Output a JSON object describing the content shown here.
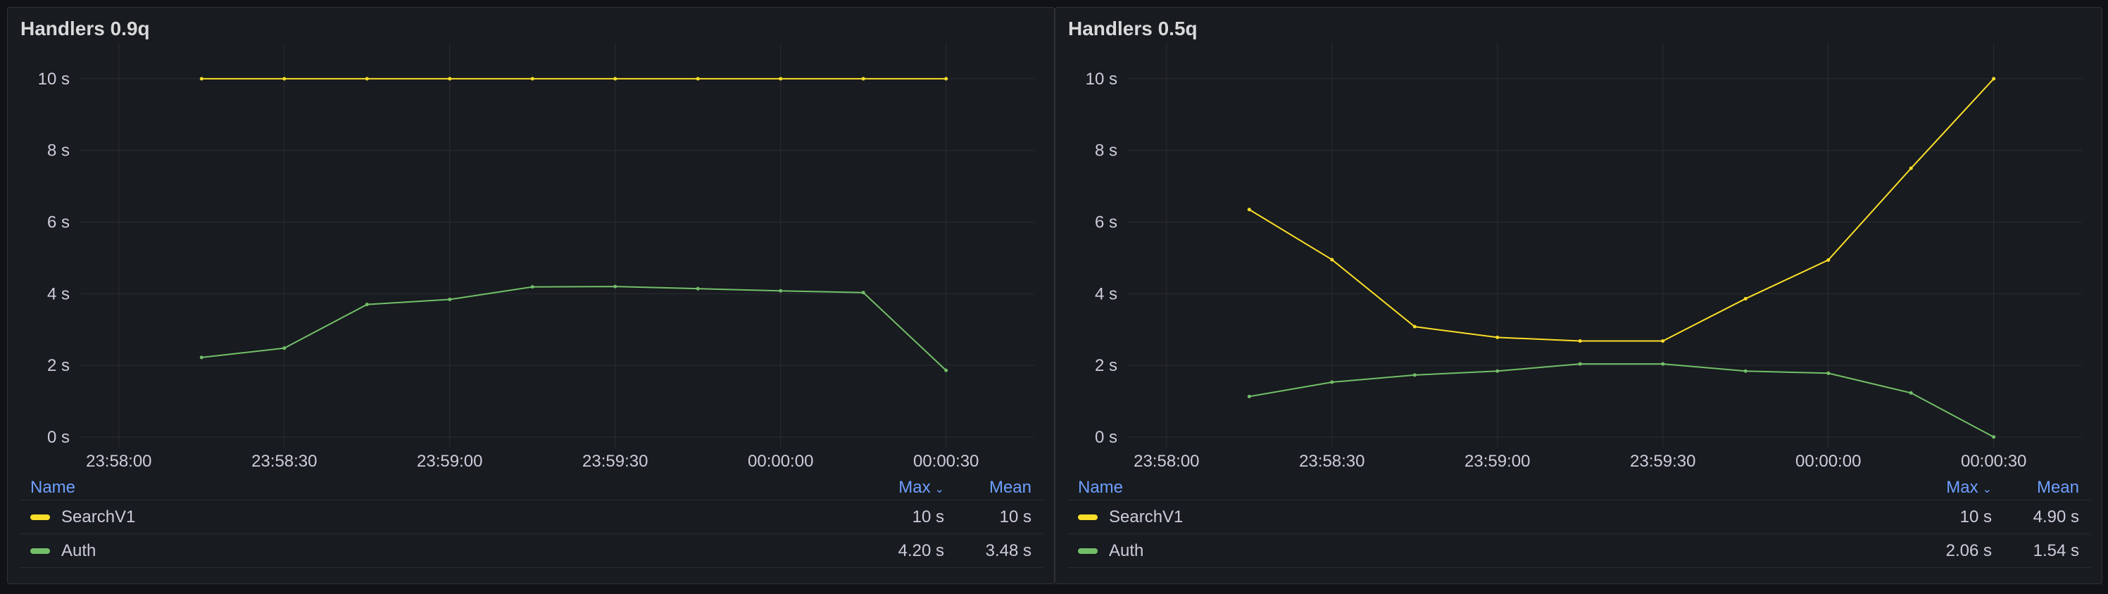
{
  "panels": [
    {
      "title": "Handlers 0.9q",
      "legend": {
        "col_name": "Name",
        "col_max": "Max",
        "col_mean": "Mean",
        "sort_icon": "chevron-down-icon",
        "rows": [
          {
            "name": "SearchV1",
            "max": "10 s",
            "mean": "10 s",
            "color": "#fade2a"
          },
          {
            "name": "Auth",
            "max": "4.20 s",
            "mean": "3.48 s",
            "color": "#73bf69"
          }
        ]
      }
    },
    {
      "title": "Handlers 0.5q",
      "legend": {
        "col_name": "Name",
        "col_max": "Max",
        "col_mean": "Mean",
        "sort_icon": "chevron-down-icon",
        "rows": [
          {
            "name": "SearchV1",
            "max": "10 s",
            "mean": "4.90 s",
            "color": "#fade2a"
          },
          {
            "name": "Auth",
            "max": "2.06 s",
            "mean": "1.54 s",
            "color": "#73bf69"
          }
        ]
      }
    }
  ],
  "chart_data": [
    {
      "type": "line",
      "title": "Handlers 0.9q",
      "x_ticks": [
        "23:58:00",
        "23:58:30",
        "23:59:00",
        "23:59:30",
        "00:00:00",
        "00:00:30"
      ],
      "x_tick_seconds": [
        0,
        30,
        60,
        90,
        120,
        150
      ],
      "y_ticks": [
        "0 s",
        "2 s",
        "4 s",
        "6 s",
        "8 s",
        "10 s"
      ],
      "y_tick_values": [
        0,
        2,
        4,
        6,
        8,
        10
      ],
      "xlim_seconds": [
        -7,
        166
      ],
      "ylim": [
        -0.1,
        11
      ],
      "grid": true,
      "legend_position": "bottom",
      "x": [
        "23:58:15",
        "23:58:30",
        "23:58:45",
        "23:59:00",
        "23:59:15",
        "23:59:30",
        "23:59:45",
        "00:00:00",
        "00:00:15",
        "00:00:30"
      ],
      "x_seconds": [
        15,
        30,
        45,
        60,
        75,
        90,
        105,
        120,
        135,
        150
      ],
      "series": [
        {
          "name": "SearchV1",
          "color": "#fade2a",
          "values": [
            10,
            10,
            10,
            10,
            10,
            10,
            10,
            10,
            10,
            10
          ]
        },
        {
          "name": "Auth",
          "color": "#73bf69",
          "values": [
            2.22,
            2.48,
            3.7,
            3.84,
            4.19,
            4.2,
            4.14,
            4.08,
            4.03,
            1.86
          ]
        }
      ]
    },
    {
      "type": "line",
      "title": "Handlers 0.5q",
      "x_ticks": [
        "23:58:00",
        "23:58:30",
        "23:59:00",
        "23:59:30",
        "00:00:00",
        "00:00:30"
      ],
      "x_tick_seconds": [
        0,
        30,
        60,
        90,
        120,
        150
      ],
      "y_ticks": [
        "0 s",
        "2 s",
        "4 s",
        "6 s",
        "8 s",
        "10 s"
      ],
      "y_tick_values": [
        0,
        2,
        4,
        6,
        8,
        10
      ],
      "xlim_seconds": [
        -7,
        166
      ],
      "ylim": [
        -0.1,
        11
      ],
      "grid": true,
      "legend_position": "bottom",
      "x": [
        "23:58:15",
        "23:58:30",
        "23:58:45",
        "23:59:00",
        "23:59:15",
        "23:59:30",
        "23:59:45",
        "00:00:00",
        "00:00:15",
        "00:00:30"
      ],
      "x_seconds": [
        15,
        30,
        45,
        60,
        75,
        90,
        105,
        120,
        135,
        150
      ],
      "series": [
        {
          "name": "SearchV1",
          "color": "#fade2a",
          "values": [
            6.35,
            4.95,
            3.08,
            2.78,
            2.68,
            2.68,
            3.86,
            4.94,
            7.5,
            10
          ]
        },
        {
          "name": "Auth",
          "color": "#73bf69",
          "values": [
            1.13,
            1.53,
            1.73,
            1.84,
            2.04,
            2.04,
            1.84,
            1.78,
            1.23,
            0
          ]
        }
      ]
    }
  ]
}
